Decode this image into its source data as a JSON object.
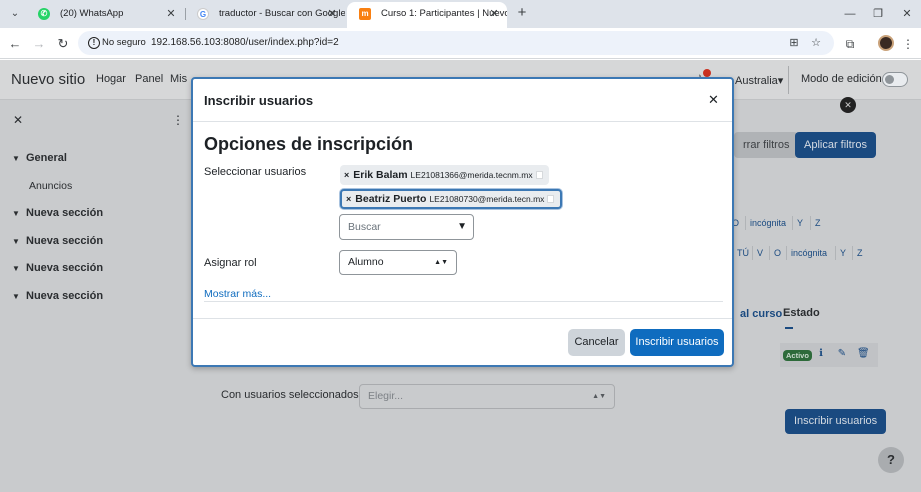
{
  "browser": {
    "tabs": [
      {
        "title": "(20) WhatsApp",
        "icon": "whatsapp-icon"
      },
      {
        "title": "traductor - Buscar con Google",
        "icon": "google-icon"
      },
      {
        "title": "Curso 1: Participantes | Nuevo s",
        "icon": "moodle-icon"
      }
    ],
    "security_label": "No seguro",
    "url": "192.168.56.103:8080/user/index.php?id=2"
  },
  "navbar": {
    "brand": "Nuevo sitio",
    "links": [
      "Hogar",
      "Panel",
      "Mis"
    ],
    "language": "Australia",
    "edit_mode_label": "Modo de edición"
  },
  "drawer": {
    "sections": [
      "General",
      "Nueva sección",
      "Nueva sección",
      "Nueva sección",
      "Nueva sección"
    ],
    "general_item": "Anuncios"
  },
  "background": {
    "clear_filters": "rrar filtros",
    "apply_filters": "Aplicar filtros",
    "letters_row1": [
      "O",
      "incógnita",
      "Y",
      "Z"
    ],
    "letters_row2": [
      "TÚ",
      "V",
      "O",
      "incógnita",
      "Y",
      "Z"
    ],
    "col_course_access": "al curso",
    "col_status": "Estado",
    "status_badge": "Activo",
    "bulk_label": "Con usuarios seleccionados...",
    "bulk_placeholder": "Elegir...",
    "enrol_button": "Inscribir usuarios",
    "help": "?"
  },
  "modal": {
    "title": "Inscribir usuarios",
    "section_title": "Opciones de inscripción",
    "select_users_label": "Seleccionar usuarios",
    "selected_users": [
      {
        "name": "Erik Balam",
        "email": "LE21081366@merida.tecnm.mx"
      },
      {
        "name": "Beatriz Puerto",
        "email": "LE21080730@merida.tecn.mx"
      }
    ],
    "search_placeholder": "Buscar",
    "role_label": "Asignar rol",
    "role_value": "Alumno",
    "show_more": "Mostrar más...",
    "cancel": "Cancelar",
    "submit": "Inscribir usuarios"
  }
}
